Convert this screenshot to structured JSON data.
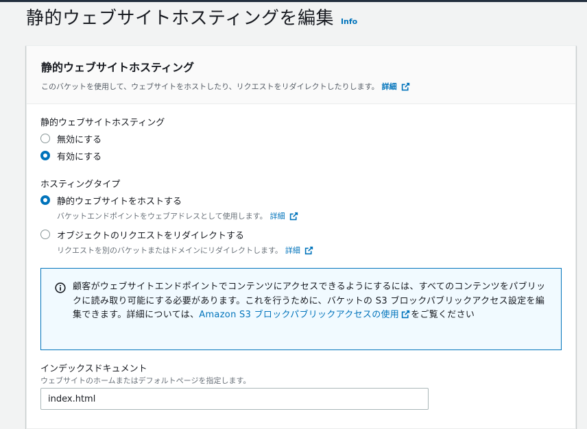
{
  "page": {
    "title": "静的ウェブサイトホスティングを編集",
    "info": "Info"
  },
  "panel": {
    "title": "静的ウェブサイトホスティング",
    "description": "このバケットを使用して、ウェブサイトをホストしたり、リクエストをリダイレクトしたりします。",
    "details_link": "詳細"
  },
  "hosting": {
    "label": "静的ウェブサイトホスティング",
    "options": [
      {
        "label": "無効にする",
        "checked": false
      },
      {
        "label": "有効にする",
        "checked": true
      }
    ]
  },
  "hosting_type": {
    "label": "ホスティングタイプ",
    "options": [
      {
        "label": "静的ウェブサイトをホストする",
        "description": "バケットエンドポイントをウェブアドレスとして使用します。",
        "link": "詳細",
        "checked": true
      },
      {
        "label": "オブジェクトのリクエストをリダイレクトする",
        "description": "リクエストを別のバケットまたはドメインにリダイレクトします。",
        "link": "詳細",
        "checked": false
      }
    ]
  },
  "alert": {
    "text_before": "顧客がウェブサイトエンドポイントでコンテンツにアクセスできるようにするには、すべてのコンテンツをパブリックに読み取り可能にする必要があります。これを行うために、バケットの S3 ブロックパブリックアクセス設定を編集できます。詳細については、",
    "link": "Amazon S3 ブロックパブリックアクセスの使用",
    "text_after": "をご覧ください"
  },
  "index_document": {
    "label": "インデックスドキュメント",
    "description": "ウェブサイトのホームまたはデフォルトページを指定します。",
    "value": "index.html"
  },
  "colors": {
    "link": "#0073bb",
    "alert_bg": "#f1faff",
    "topbar": "#232f3e"
  }
}
